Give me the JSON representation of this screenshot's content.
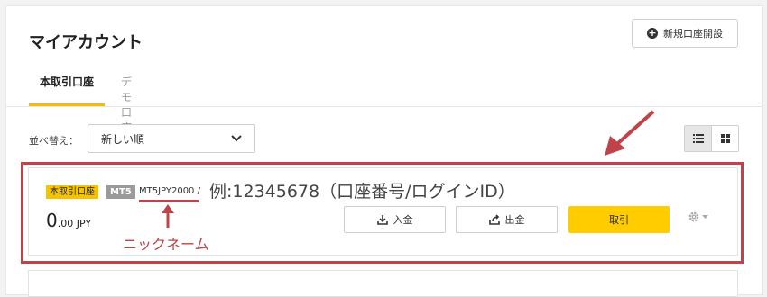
{
  "header": {
    "title": "マイアカウント",
    "new_account_label": "新規口座開設"
  },
  "tabs": [
    {
      "label": "本取引口座",
      "active": true
    },
    {
      "label": "デモ口座",
      "active": false
    }
  ],
  "sort": {
    "label": "並べ替え：",
    "selected": "新しい順"
  },
  "account": {
    "type_badge": "本取引口座",
    "platform_badge": "MT5",
    "nickname": "MT5JPY2000 /",
    "balance_int": "0",
    "balance_dec": ".00 JPY",
    "deposit_label": "入金",
    "withdraw_label": "出金",
    "trade_label": "取引"
  },
  "annotations": {
    "example_text": "例:12345678（口座番号/ログインID）",
    "nickname_label": "ニックネーム",
    "highlight_color": "#c0434a"
  },
  "colors": {
    "accent": "#ffcc00",
    "badge_yellow": "#f5c400",
    "badge_gray": "#9a9a9a"
  }
}
